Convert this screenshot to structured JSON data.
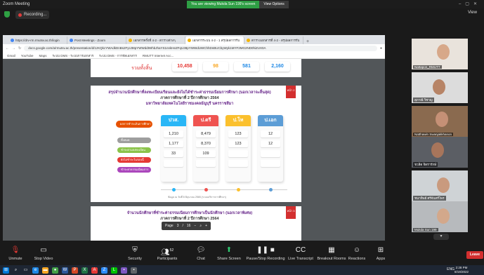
{
  "window": {
    "title": "Zoom Meeting"
  },
  "share_banner": {
    "message": "You are viewing Mukda Sun 199's screen",
    "view_options": "View Options"
  },
  "recording": {
    "label": "Recording..."
  },
  "view_button": "View",
  "browser": {
    "tabs": [
      {
        "label": "https://drv-rm.rmutsv.ac.th/login"
      },
      {
        "label": "Post Meetings - Zoom"
      },
      {
        "label": "เอกสารครั้งที่ 4-2 - ตารางต่างๆ"
      },
      {
        "label": "เอกสารระบบ 4-2 - 1 สรุปผลการรับ"
      },
      {
        "label": "ตารางเอกสารที่ 4-2 - สรุปผลการรับ"
      }
    ],
    "address": "docs.google.com/a/rmutsv.ac.th/presentation/d/1zKQkcYWAdkDnBs2FyU38pYWWddIWhbJhaYS1nnkHeZFqU38pYWWdUWChhDnBUCbyWyk1MYF2MG2ND0hiZUX0A",
    "bookmarks": [
      "Gmail",
      "YouTube",
      "Maps",
      "ระบบ DMS - ระบบการเอกสาร",
      "ระบบ DMS - การจัดเอกสาร",
      "RMUTT Internet Acc..."
    ]
  },
  "slide1": {
    "label": "รวมทั้งสิ้น",
    "totals": [
      {
        "value": "10,458",
        "color": "#e53935"
      },
      {
        "value": "98",
        "color": "#f9a825"
      },
      {
        "value": "581",
        "color": "#1e88e5"
      },
      {
        "value": "2,160",
        "color": "#1e88e5"
      }
    ]
  },
  "slide2": {
    "title_lines": [
      "สรุปจำนวนนักศึกษาที่ลงทะเบียนเรียนและยังไม่ได้ชำระค่าธรรมเนียมการศึกษา (นอกเวลาจะสิ้นสุด)",
      "ภาคการศึกษาที่ 2 ปีการศึกษา 2564",
      "มหาวิทยาลัยเทคโนโลยีราชมงคลธัญบุรี นครราชสีมา"
    ],
    "badge": "หน้า 2",
    "panel_header": "ผลการชำระเงินการศึกษา",
    "rows": [
      {
        "label": "ทั้งหมด",
        "color": "#9e9e9e"
      },
      {
        "label": "ชำระตามลงทะเบียน",
        "color": "#8bc34a"
      },
      {
        "label": "ยังไม่ชำระในรอบนี้",
        "color": "#e53935"
      },
      {
        "label": "ชำระค่าธรรมเนียมการศึกษาภายหลัง",
        "color": "#ab47bc"
      }
    ],
    "columns": [
      {
        "head": "ปวส.",
        "color": "#29b6f6",
        "values": [
          "1,210",
          "1,177",
          "33",
          ""
        ]
      },
      {
        "head": "ป.ตรี",
        "color": "#ef5350",
        "values": [
          "8,479",
          "8,370",
          "109",
          ""
        ]
      },
      {
        "head": "ป.โท",
        "color": "#fbc02d",
        "values": [
          "123",
          "123",
          "",
          ""
        ]
      },
      {
        "head": "ป.เอก",
        "color": "#5c9dd6",
        "values": [
          "12",
          "12",
          "",
          ""
        ]
      }
    ],
    "footnote": "ข้อมูล ณ วันที่ 8 มิถุนายน 2565 (ระบบบริการการศึกษา)"
  },
  "slide3": {
    "title_lines": [
      "จำนวนนักศึกษาที่ชำระค่าธรรมเนียมการศึกษาเป็นนักศึกษา (นอกเวลาพิเศษ)",
      "ภาคการศึกษาที่ 2 ปีการศึกษา 2564"
    ],
    "badge": "หน้า 3"
  },
  "pager": {
    "page_label": "Page",
    "current": "3",
    "separator": "/",
    "total": "16"
  },
  "participants": [
    {
      "name": "Nattapon_RMUTT"
    },
    {
      "name": "สุภาณี วิชาญ"
    },
    {
      "name": "Natthawin Swanjakkhanon"
    },
    {
      "name": "ชวลิต จิตรารักษ์"
    },
    {
      "name": "ชนาทิพย์ ศรีจันทร์ไพร"
    },
    {
      "name": "Mukda Sun 199"
    }
  ],
  "toolbar": {
    "unmute": "Unmute",
    "stop_video": "Stop Video",
    "security": "Security",
    "participants": "Participants",
    "participants_count": "52",
    "chat": "Chat",
    "share_screen": "Share Screen",
    "pause_stop_recording": "Pause/Stop Recording",
    "live_transcript": "Live Transcript",
    "breakout_rooms": "Breakout Rooms",
    "reactions": "Reactions",
    "apps": "Apps",
    "leave": "Leave"
  },
  "taskbar": {
    "language": "ENG",
    "time": "2:28 PM",
    "date": "8/19/2022"
  }
}
